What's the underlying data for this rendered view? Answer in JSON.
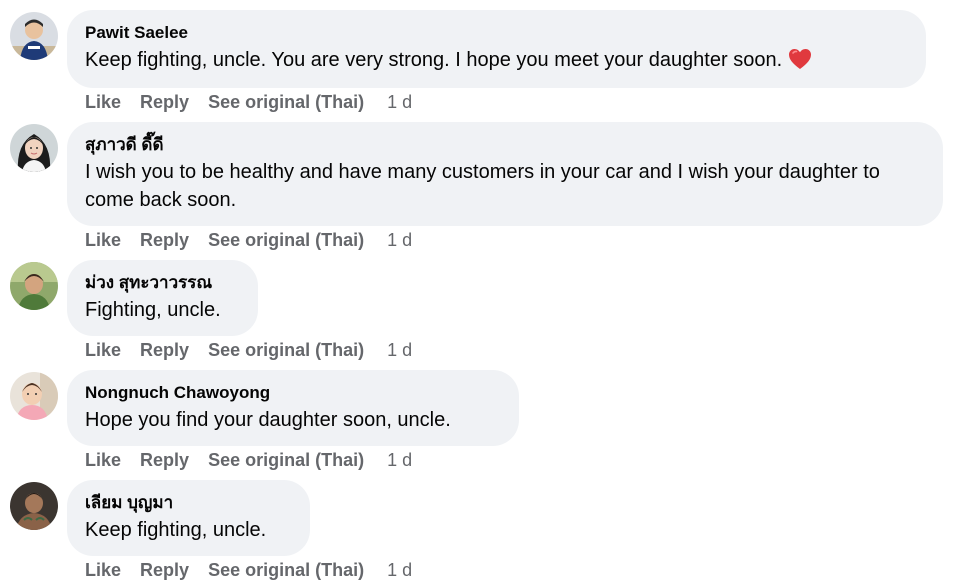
{
  "action_labels": {
    "like": "Like",
    "reply": "Reply",
    "see_original": "See original (Thai)"
  },
  "comments": [
    {
      "author": "Pawit Saelee",
      "text": "Keep fighting, uncle. You are very strong. I hope you meet your daughter soon.",
      "reaction_emoji": "heart",
      "time": "1 d"
    },
    {
      "author": "สุภาวดี ดี๊ดี",
      "text": "I wish you to be healthy and have many customers in your car and I wish your daughter to come back soon.",
      "time": "1 d"
    },
    {
      "author": "ม่วง สุทะวาวรรณ",
      "text": "Fighting, uncle.",
      "time": "1 d"
    },
    {
      "author": "Nongnuch Chawoyong",
      "text": "Hope you find your daughter soon, uncle.",
      "time": "1 d"
    },
    {
      "author": "เลียม บุญมา",
      "text": "Keep fighting, uncle.",
      "time": "1 d"
    }
  ],
  "colors": {
    "bubble": "#f0f2f5",
    "meta_text": "#65676b",
    "heart": "#e0393e"
  }
}
